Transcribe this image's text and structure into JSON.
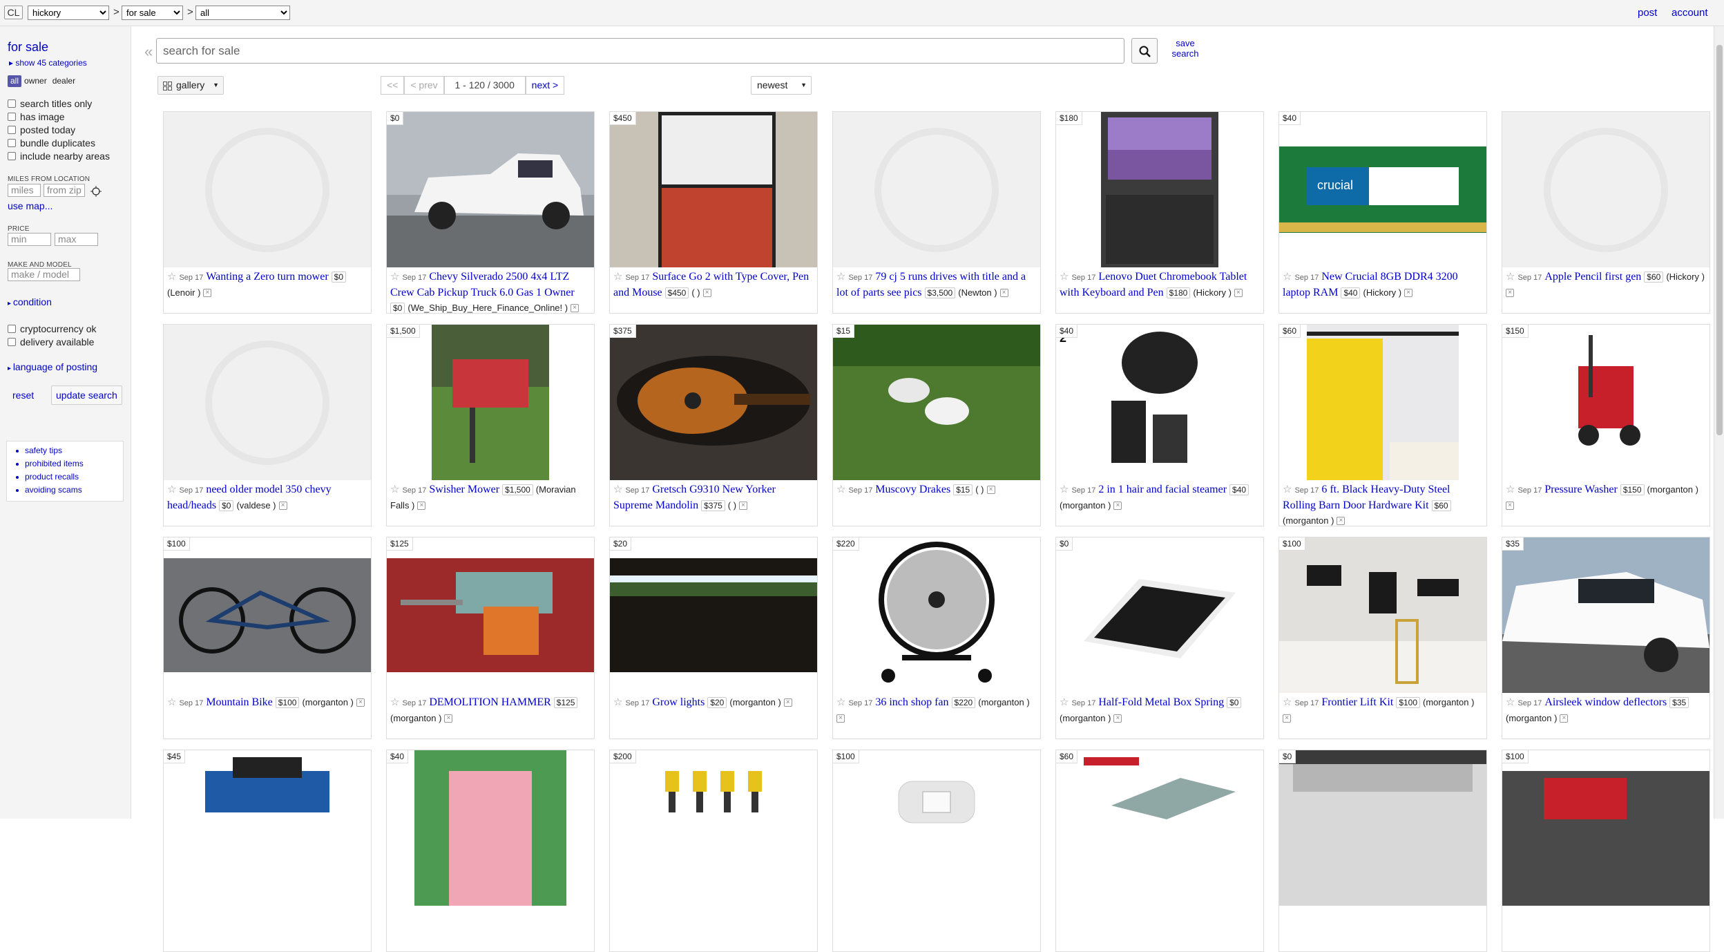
{
  "topbar": {
    "logo": "CL",
    "location": "hickory",
    "section": "for sale",
    "category": "all",
    "sep": ">",
    "post": "post",
    "account": "account"
  },
  "sidebar": {
    "title": "for sale",
    "show_categories": "show 45 categories",
    "seller_toggle": [
      "all",
      "owner",
      "dealer"
    ],
    "filters": [
      "search titles only",
      "has image",
      "posted today",
      "bundle duplicates",
      "include nearby areas"
    ],
    "miles_label": "MILES FROM LOCATION",
    "miles_placeholder": "miles",
    "zip_placeholder": "from zip",
    "use_map": "use map...",
    "price_label": "PRICE",
    "min_placeholder": "min",
    "max_placeholder": "max",
    "make_label": "MAKE AND MODEL",
    "make_placeholder": "make / model",
    "condition": "condition",
    "extra_filters": [
      "cryptocurrency ok",
      "delivery available"
    ],
    "language": "language of posting",
    "reset": "reset",
    "update": "update search",
    "help_links": [
      "safety tips",
      "prohibited items",
      "product recalls",
      "avoiding scams"
    ]
  },
  "search": {
    "placeholder": "search for sale",
    "save": "save search"
  },
  "toolbar": {
    "view": "gallery",
    "first": "<<",
    "prev": "< prev",
    "range": "1 - 120 / 3000",
    "next": "next >",
    "sort": "newest"
  },
  "listings": [
    {
      "price": "",
      "date": "Sep 17",
      "title": "Wanting a Zero turn mower",
      "tag": "$0",
      "hood": "(Lenoir )",
      "img": "placeholder"
    },
    {
      "price": "$0",
      "date": "Sep 17",
      "title": "Chevy Silverado 2500 4x4 LTZ Crew Cab Pickup Truck 6.0 Gas 1 Owner",
      "tag": "$0",
      "hood": "(We_Ship_Buy_Here_Finance_Online! )",
      "img": "truck-white"
    },
    {
      "price": "$450",
      "date": "Sep 17",
      "title": "Surface Go 2 with Type Cover, Pen and Mouse",
      "tag": "$450",
      "hood": "( )",
      "img": "tablet-red"
    },
    {
      "price": "",
      "date": "Sep 17",
      "title": "79 cj 5 runs drives with title and a lot of parts see pics",
      "tag": "$3,500",
      "hood": "(Newton )",
      "img": "placeholder"
    },
    {
      "price": "$180",
      "date": "Sep 17",
      "title": "Lenovo Duet Chromebook Tablet with Keyboard and Pen",
      "tag": "$180",
      "hood": "(Hickory )",
      "img": "laptop"
    },
    {
      "price": "$40",
      "date": "Sep 17",
      "title": "New Crucial 8GB DDR4 3200 laptop RAM",
      "tag": "$40",
      "hood": "(Hickory )",
      "img": "ram"
    },
    {
      "price": "",
      "date": "Sep 17",
      "title": "Apple Pencil first gen",
      "tag": "$60",
      "hood": "(Hickory )",
      "img": "placeholder"
    },
    {
      "price": "",
      "date": "Sep 17",
      "title": "need older model 350 chevy head/heads",
      "tag": "$0",
      "hood": "(valdese )",
      "img": "placeholder"
    },
    {
      "price": "$1,500",
      "date": "Sep 17",
      "title": "Swisher Mower",
      "tag": "$1,500",
      "hood": "(Moravian Falls )",
      "img": "mower"
    },
    {
      "price": "$375",
      "date": "Sep 17",
      "title": "Gretsch G9310 New Yorker Supreme Mandolin",
      "tag": "$375",
      "hood": "( )",
      "img": "mandolin"
    },
    {
      "price": "$15",
      "date": "Sep 17",
      "title": "Muscovy Drakes",
      "tag": "$15",
      "hood": "( )",
      "img": "ducks"
    },
    {
      "price": "$40",
      "date": "Sep 17",
      "title": "2 in 1 hair and facial steamer",
      "tag": "$40",
      "hood": "(morganton )",
      "img": "steamer"
    },
    {
      "price": "$60",
      "date": "Sep 17",
      "title": "6 ft. Black Heavy-Duty Steel Rolling Barn Door Hardware Kit",
      "tag": "$60",
      "hood": "(morganton )",
      "img": "barndoor"
    },
    {
      "price": "$150",
      "date": "Sep 17",
      "title": "Pressure Washer",
      "tag": "$150",
      "hood": "(morganton )",
      "img": "washer"
    },
    {
      "price": "$100",
      "date": "Sep 17",
      "title": "Mountain Bike",
      "tag": "$100",
      "hood": "(morganton )",
      "img": "bike"
    },
    {
      "price": "$125",
      "date": "Sep 17",
      "title": "DEMOLITION HAMMER",
      "tag": "$125",
      "hood": "(morganton )",
      "img": "hammer"
    },
    {
      "price": "$20",
      "date": "Sep 17",
      "title": "Grow lights",
      "tag": "$20",
      "hood": "(morganton )",
      "img": "growlight"
    },
    {
      "price": "$220",
      "date": "Sep 17",
      "title": "36 inch shop fan",
      "tag": "$220",
      "hood": "(morganton )",
      "img": "fan"
    },
    {
      "price": "$0",
      "date": "Sep 17",
      "title": "Half-Fold Metal Box Spring",
      "tag": "$0",
      "hood": "(morganton )",
      "img": "boxspring"
    },
    {
      "price": "$100",
      "date": "Sep 17",
      "title": "Frontier Lift Kit",
      "tag": "$100",
      "hood": "(morganton )",
      "img": "liftkit"
    },
    {
      "price": "$35",
      "date": "Sep 17",
      "title": "Airsleek window deflectors",
      "tag": "$35",
      "hood": "(morganton )",
      "img": "truck-white2"
    },
    {
      "price": "$45",
      "date": "",
      "title": "",
      "tag": "",
      "hood": "",
      "img": "blue-machine"
    },
    {
      "price": "$40",
      "date": "",
      "title": "",
      "tag": "",
      "hood": "",
      "img": "pink"
    },
    {
      "price": "$200",
      "date": "",
      "title": "",
      "tag": "",
      "hood": "",
      "img": "coils"
    },
    {
      "price": "$100",
      "date": "",
      "title": "",
      "tag": "",
      "hood": "",
      "img": "outlet"
    },
    {
      "price": "$60",
      "date": "",
      "title": "",
      "tag": "",
      "hood": "",
      "img": "vise"
    },
    {
      "price": "$0",
      "date": "",
      "title": "",
      "tag": "",
      "hood": "",
      "img": "treadmill"
    },
    {
      "price": "$100",
      "date": "",
      "title": "",
      "tag": "",
      "hood": "",
      "img": "redtool"
    }
  ]
}
